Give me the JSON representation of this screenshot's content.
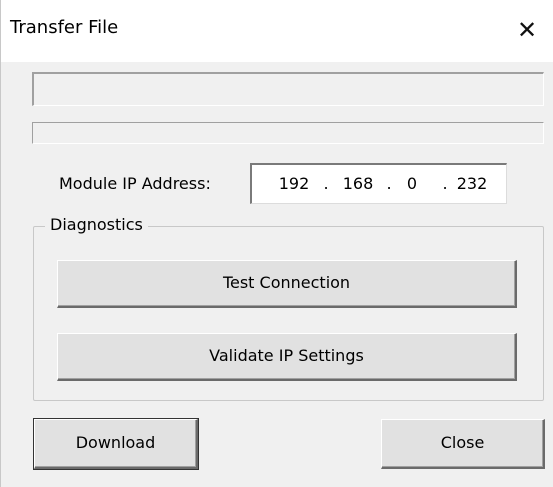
{
  "window": {
    "title": "Transfer File",
    "close_glyph": "✕"
  },
  "ip": {
    "label": "Module IP Address:",
    "octets": [
      "192",
      "168",
      "0",
      "232"
    ],
    "separator": "."
  },
  "diagnostics": {
    "legend": "Diagnostics",
    "test_button": "Test Connection",
    "validate_button": "Validate IP Settings"
  },
  "footer": {
    "download_button": "Download",
    "close_button": "Close"
  }
}
